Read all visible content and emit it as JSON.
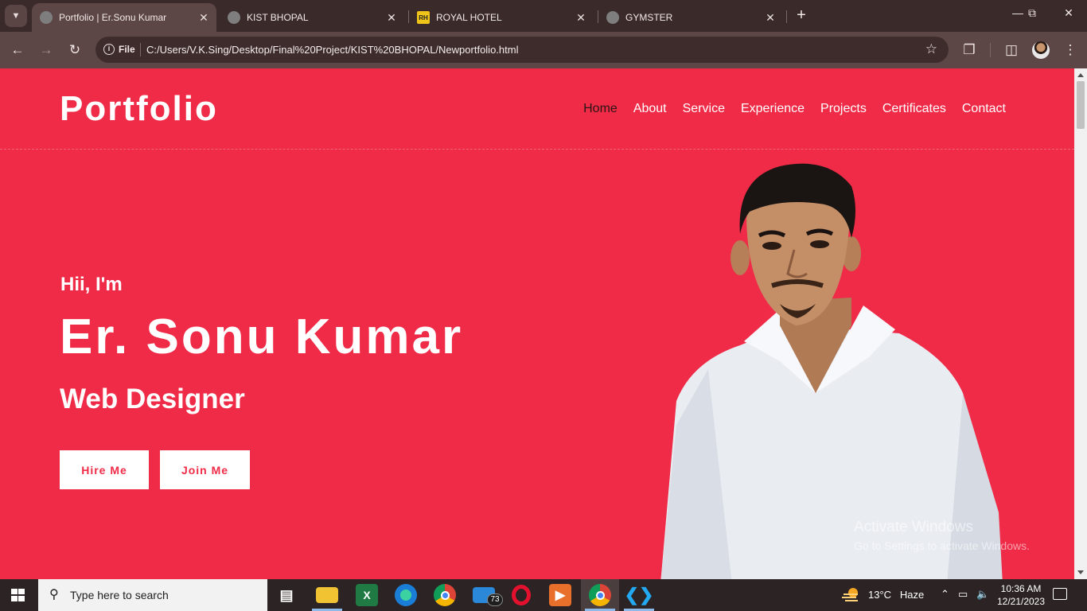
{
  "browser": {
    "tabs": [
      {
        "title": "Portfolio | Er.Sonu Kumar",
        "active": true,
        "favicon": "globe-icon"
      },
      {
        "title": "KIST BHOPAL",
        "active": false,
        "favicon": "globe-icon"
      },
      {
        "title": "ROYAL HOTEL",
        "active": false,
        "favicon": "royal-hotel-logo"
      },
      {
        "title": "GYMSTER",
        "active": false,
        "favicon": "globe-icon"
      }
    ],
    "address": {
      "scheme_label": "File",
      "url": "C:/Users/V.K.Sing/Desktop/Final%20Project/KIST%20BHOPAL/Newportfolio.html"
    },
    "favicon_rh_text": "RH"
  },
  "page": {
    "logo": "Portfolio",
    "nav": [
      "Home",
      "About",
      "Service",
      "Experience",
      "Projects",
      "Certificates",
      "Contact"
    ],
    "active_nav": "Home",
    "hero": {
      "greeting": "Hii, I'm",
      "name": "Er. Sonu Kumar",
      "role": "Web Designer",
      "buttons": [
        "Hire Me",
        "Join Me"
      ]
    },
    "colors": {
      "primary": "#ef2b47",
      "text": "#ffffff",
      "active_nav": "#2a1414"
    }
  },
  "watermark": {
    "line1": "Activate Windows",
    "line2": "Go to Settings to activate Windows."
  },
  "taskbar": {
    "search_placeholder": "Type here to search",
    "mail_badge": "73",
    "weather": {
      "temp": "13°C",
      "condition": "Haze"
    },
    "time": "10:36 AM",
    "date": "12/21/2023",
    "apps": [
      "task-view-icon",
      "file-explorer-icon",
      "excel-icon",
      "edge-icon",
      "chrome-icon",
      "mail-icon",
      "opera-icon",
      "media-player-icon",
      "chrome-profile-icon",
      "vscode-icon"
    ]
  }
}
